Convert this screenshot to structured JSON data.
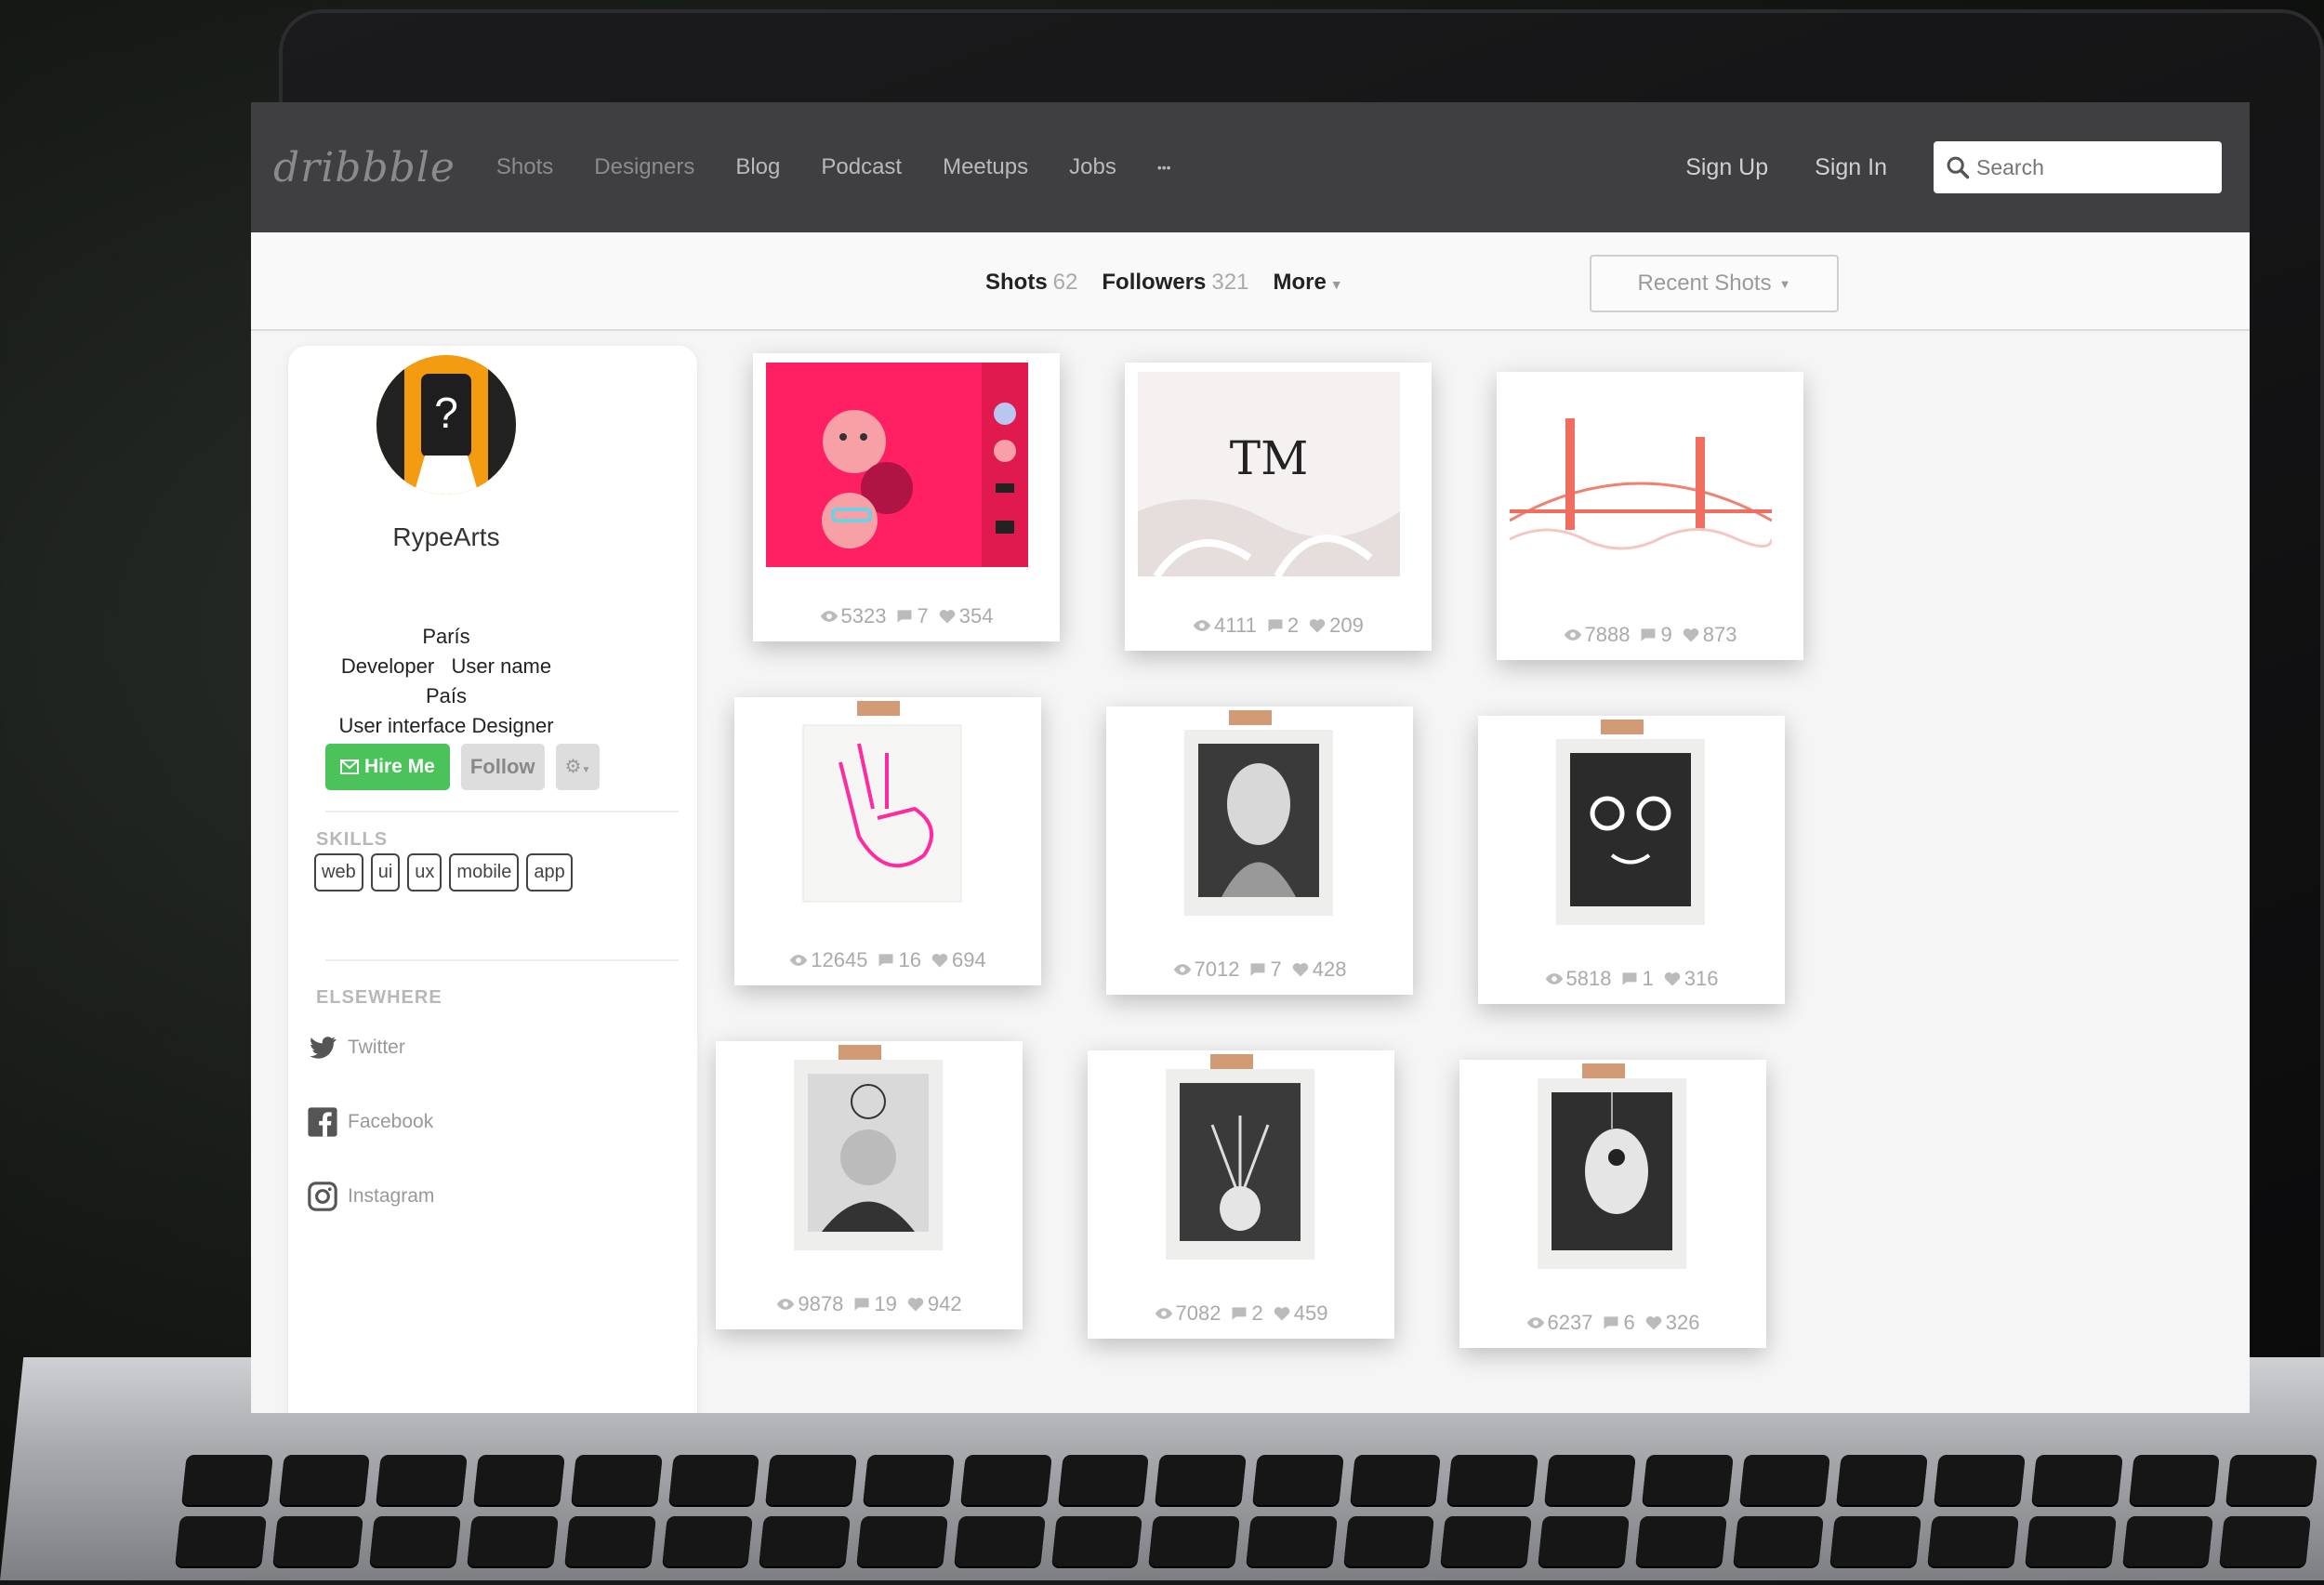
{
  "nav": {
    "logo": "dribbble",
    "items": [
      "Shots",
      "Designers",
      "Blog",
      "Podcast",
      "Meetups",
      "Jobs",
      "•••"
    ],
    "signup": "Sign Up",
    "signin": "Sign In",
    "search_placeholder": "Search"
  },
  "subnav": {
    "shots_label": "Shots",
    "shots_count": "62",
    "followers_label": "Followers",
    "followers_count": "321",
    "more_label": "More",
    "recent_label": "Recent Shots"
  },
  "profile": {
    "username": "RypeArts",
    "city": "París",
    "role": "Developer",
    "user_name_label": "User name",
    "country": "País",
    "title": "User interface Designer",
    "hire_label": "Hire Me",
    "follow_label": "Follow",
    "skills_heading": "SKILLS",
    "skills": [
      "web",
      "ui",
      "ux",
      "mobile",
      "app"
    ],
    "elsewhere_heading": "ELSEWHERE",
    "social": [
      {
        "label": "Twitter",
        "icon": "twitter-icon"
      },
      {
        "label": "Facebook",
        "icon": "facebook-icon"
      },
      {
        "label": "Instagram",
        "icon": "instagram-icon"
      }
    ]
  },
  "shots": [
    {
      "views": "5323",
      "comments": "7",
      "likes": "354",
      "art": "pink-faces"
    },
    {
      "views": "4111",
      "comments": "2",
      "likes": "209",
      "art": "tm-logo"
    },
    {
      "views": "7888",
      "comments": "9",
      "likes": "873",
      "art": "golden-gate"
    },
    {
      "views": "12645",
      "comments": "16",
      "likes": "694",
      "art": "pink-hand"
    },
    {
      "views": "7012",
      "comments": "7",
      "likes": "428",
      "art": "patterned-bust"
    },
    {
      "views": "5818",
      "comments": "1",
      "likes": "316",
      "art": "glasses-face"
    },
    {
      "views": "9878",
      "comments": "19",
      "likes": "942",
      "art": "cap-person"
    },
    {
      "views": "7082",
      "comments": "2",
      "likes": "459",
      "art": "plant-vase"
    },
    {
      "views": "6237",
      "comments": "6",
      "likes": "326",
      "art": "birdhouse"
    }
  ],
  "colors": {
    "nav_bg": "#3f3f42",
    "hire_green": "#4cc35a",
    "pink": "#ff1f63"
  }
}
